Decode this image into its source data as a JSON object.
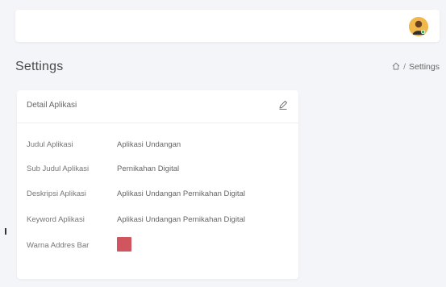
{
  "page": {
    "title": "Settings"
  },
  "breadcrumb": {
    "separator": "/",
    "current": "Settings"
  },
  "card": {
    "title": "Detail Aplikasi",
    "rows": [
      {
        "label": "Judul Aplikasi",
        "value": "Aplikasi Undangan"
      },
      {
        "label": "Sub Judul Aplikasi",
        "value": "Pernikahan Digital"
      },
      {
        "label": "Deskripsi Aplikasi",
        "value": "Aplikasi Undangan Pernikahan Digital"
      },
      {
        "label": "Keyword Aplikasi",
        "value": "Aplikasi Undangan Pernikahan Digital"
      },
      {
        "label": "Warna Addres Bar",
        "value_color": "#d1555e"
      }
    ]
  },
  "icons": {
    "avatar": "user-avatar",
    "breadcrumb_home": "home-icon",
    "edit": "pencil-icon"
  }
}
